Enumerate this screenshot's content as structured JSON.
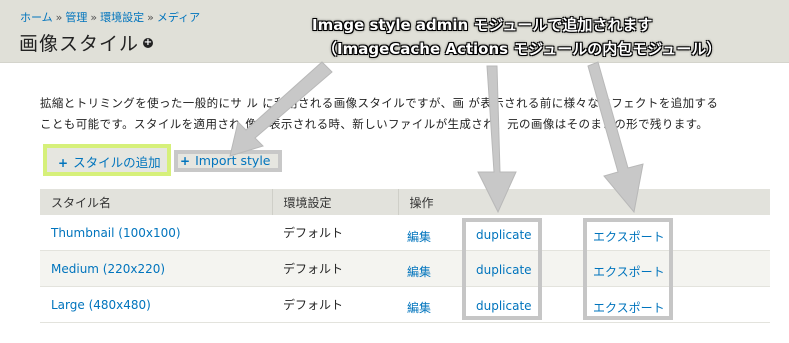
{
  "breadcrumb": [
    {
      "label": "ホーム"
    },
    {
      "label": "管理"
    },
    {
      "label": "環境設定"
    },
    {
      "label": "メディア"
    }
  ],
  "breadcrumb_separator": "»",
  "page": {
    "title": "画像スタイル",
    "shortcut_glyph": "+"
  },
  "help_text": {
    "line1": "拡縮とトリミングを使った一般的にサ  ル  に利用される画像スタイルですが、画  が表示される前に様々なエフェクトを追加する",
    "line2": "ことも可能です。スタイルを適用され  像が表示される時、新しいファイルが生成され、元の画像はそのままの形で残ります。"
  },
  "actions": {
    "add_label": "スタイルの追加",
    "import_label": "Import style",
    "plus_glyph": "+"
  },
  "table": {
    "headers": [
      "スタイル名",
      "環境設定",
      "操作"
    ],
    "rows": [
      {
        "name": "Thumbnail (100x100)",
        "setting": "デフォルト",
        "edit": "編集",
        "duplicate": "duplicate",
        "export": "エクスポート"
      },
      {
        "name": "Medium (220x220)",
        "setting": "デフォルト",
        "edit": "編集",
        "duplicate": "duplicate",
        "export": "エクスポート"
      },
      {
        "name": "Large (480x480)",
        "setting": "デフォルト",
        "edit": "編集",
        "duplicate": "duplicate",
        "export": "エクスポート"
      }
    ]
  },
  "annotations": {
    "line1": "Image style admin モジュールで追加されます",
    "line2": "（ImageCache Actions モジュールの内包モジュール）"
  },
  "colors": {
    "link": "#0074bd",
    "header_bg": "#e0e0d8",
    "highlight_green": "#d6f07a",
    "highlight_gray": "#c6c6c6",
    "arrow_fill": "#c8c8c8"
  }
}
